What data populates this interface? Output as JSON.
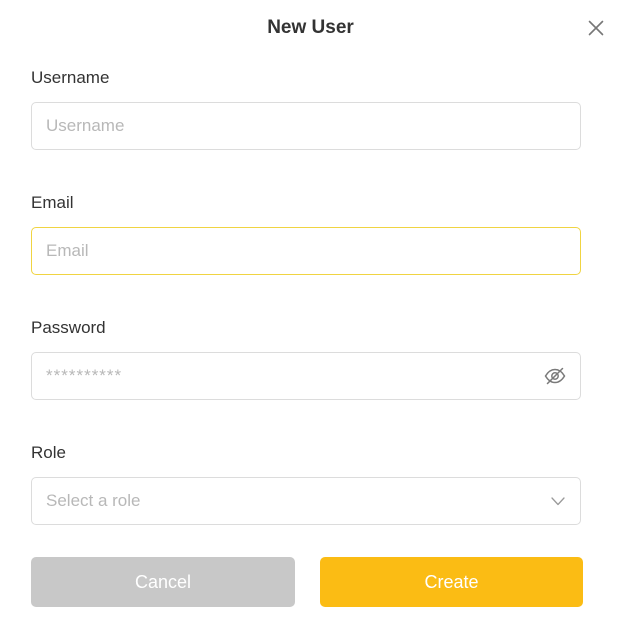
{
  "dialog": {
    "title": "New User",
    "close_icon": "close-icon"
  },
  "fields": {
    "username": {
      "label": "Username",
      "placeholder": "Username",
      "value": ""
    },
    "email": {
      "label": "Email",
      "placeholder": "Email",
      "value": ""
    },
    "password": {
      "label": "Password",
      "placeholder": "**********",
      "toggle_icon": "eye-off-icon"
    },
    "role": {
      "label": "Role",
      "placeholder": "Select a role",
      "chevron_icon": "chevron-down-icon"
    }
  },
  "actions": {
    "cancel_label": "Cancel",
    "create_label": "Create"
  },
  "colors": {
    "focus_border": "#f0d442",
    "primary": "#fbbc14",
    "cancel": "#c8c8c8"
  }
}
